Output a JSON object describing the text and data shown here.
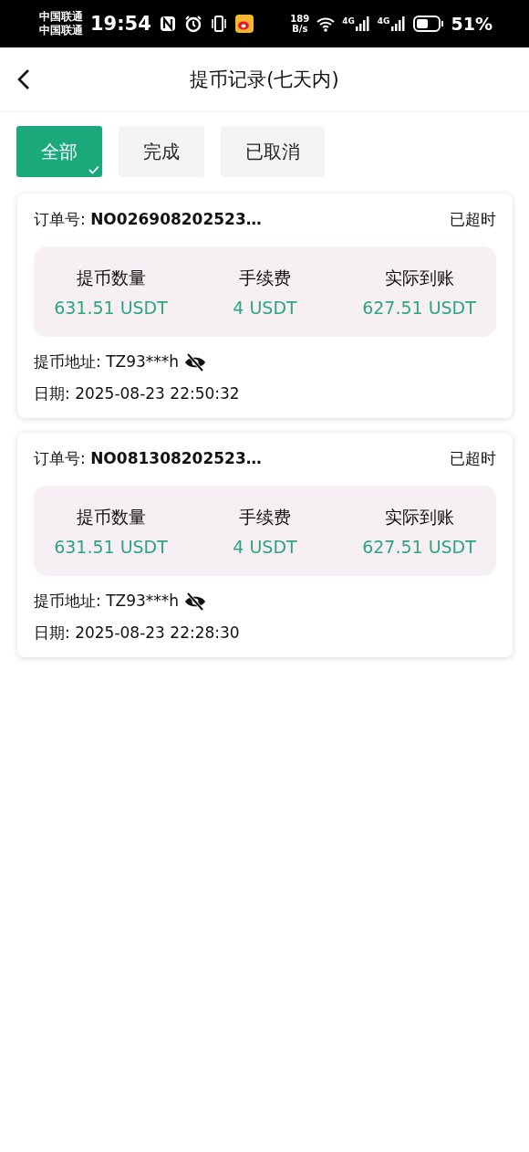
{
  "status_bar": {
    "carriers": [
      "中国联通",
      "中国联通"
    ],
    "time": "19:54",
    "net_speed": [
      "189",
      "B/s"
    ],
    "signals": [
      "4G",
      "4G"
    ],
    "battery": "51%"
  },
  "header": {
    "title": "提币记录(七天内)"
  },
  "tabs": [
    {
      "label": "全部",
      "selected": true
    },
    {
      "label": "完成",
      "selected": false
    },
    {
      "label": "已取消",
      "selected": false
    }
  ],
  "records": [
    {
      "order": "订单号: **NO026908202523…**",
      "status": "已超时",
      "stats": [
        {
          "label": "提币数量",
          "value": "631.51 USDT"
        },
        {
          "label": "手续费",
          "value": "4 USDT"
        },
        {
          "label": "实际到账",
          "value": "627.51 USDT"
        }
      ],
      "address": "提币地址: TZ93***h",
      "date": "日期: 2025-08-23 22:50:32"
    },
    {
      "order": "订单号: **NO081308202523…**",
      "status": "已超时",
      "stats": [
        {
          "label": "提币数量",
          "value": "631.51 USDT"
        },
        {
          "label": "手续费",
          "value": "4 USDT"
        },
        {
          "label": "实际到账",
          "value": "627.51 USDT"
        }
      ],
      "address": "提币地址: TZ93***h",
      "date": "日期: 2025-08-23 22:28:30"
    }
  ]
}
